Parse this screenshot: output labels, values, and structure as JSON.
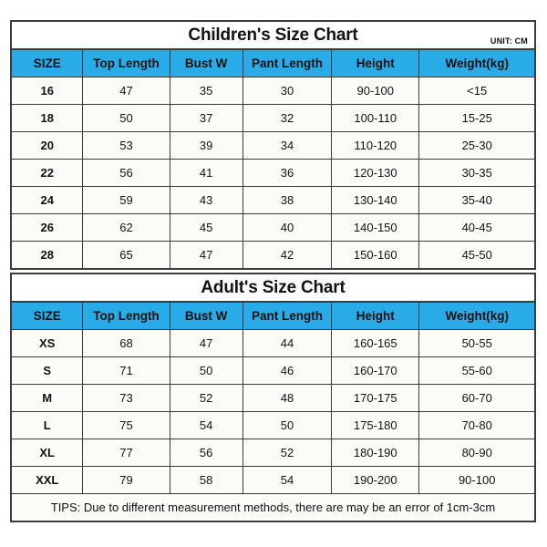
{
  "columns": [
    "SIZE",
    "Top Length",
    "Bust W",
    "Pant Length",
    "Height",
    "Weight(kg)"
  ],
  "colors": {
    "header_blue": "#29ABE8",
    "cell_background": "#fbfbf8",
    "border": "#3b3b3b",
    "tips_red": "#DD2222",
    "text": "#111111"
  },
  "children_chart": {
    "title": "Children's Size Chart",
    "unit": "UNIT: CM",
    "columns": [
      "SIZE",
      "Top Length",
      "Bust W",
      "Pant Length",
      "Height",
      "Weight(kg)"
    ],
    "rows": [
      [
        "16",
        "47",
        "35",
        "30",
        "90-100",
        "<15"
      ],
      [
        "18",
        "50",
        "37",
        "32",
        "100-110",
        "15-25"
      ],
      [
        "20",
        "53",
        "39",
        "34",
        "110-120",
        "25-30"
      ],
      [
        "22",
        "56",
        "41",
        "36",
        "120-130",
        "30-35"
      ],
      [
        "24",
        "59",
        "43",
        "38",
        "130-140",
        "35-40"
      ],
      [
        "26",
        "62",
        "45",
        "40",
        "140-150",
        "40-45"
      ],
      [
        "28",
        "65",
        "47",
        "42",
        "150-160",
        "45-50"
      ]
    ]
  },
  "adult_chart": {
    "title": "Adult's Size Chart",
    "columns": [
      "SIZE",
      "Top Length",
      "Bust W",
      "Pant Length",
      "Height",
      "Weight(kg)"
    ],
    "rows": [
      [
        "XS",
        "68",
        "47",
        "44",
        "160-165",
        "50-55"
      ],
      [
        "S",
        "71",
        "50",
        "46",
        "160-170",
        "55-60"
      ],
      [
        "M",
        "73",
        "52",
        "48",
        "170-175",
        "60-70"
      ],
      [
        "L",
        "75",
        "54",
        "50",
        "175-180",
        "70-80"
      ],
      [
        "XL",
        "77",
        "56",
        "52",
        "180-190",
        "80-90"
      ],
      [
        "XXL",
        "79",
        "58",
        "54",
        "190-200",
        "90-100"
      ]
    ],
    "tips": "TIPS: Due to different measurement methods, there are may be an error of 1cm-3cm"
  }
}
